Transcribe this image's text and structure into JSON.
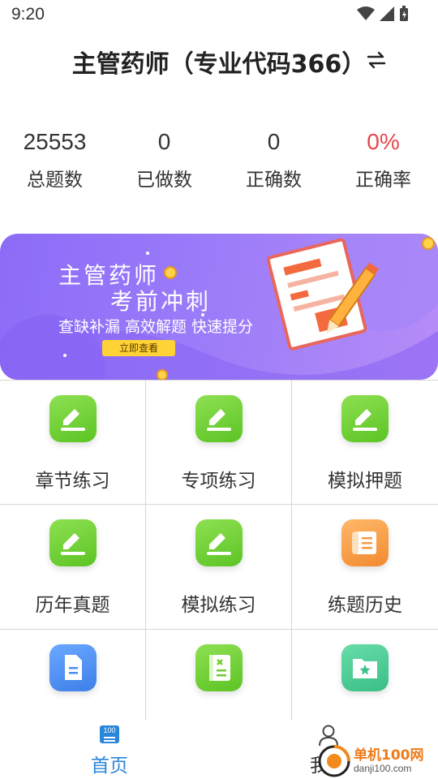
{
  "status_bar": {
    "time": "9:20"
  },
  "header": {
    "title": "主管药师（专业代码366）"
  },
  "stats": [
    {
      "value": "25553",
      "label": "总题数"
    },
    {
      "value": "0",
      "label": "已做数"
    },
    {
      "value": "0",
      "label": "正确数"
    },
    {
      "value": "0%",
      "label": "正确率"
    }
  ],
  "banner": {
    "line1": "主管药师",
    "line2": "考前冲刺",
    "tagline": "查缺补漏 高效解题 快速提分",
    "button": "立即查看"
  },
  "menu": [
    {
      "label": "章节练习",
      "icon": "pencil-icon",
      "color": "green"
    },
    {
      "label": "专项练习",
      "icon": "pencil-icon",
      "color": "green"
    },
    {
      "label": "模拟押题",
      "icon": "pencil-icon",
      "color": "green"
    },
    {
      "label": "历年真题",
      "icon": "pencil-icon",
      "color": "green"
    },
    {
      "label": "模拟练习",
      "icon": "pencil-icon",
      "color": "green"
    },
    {
      "label": "练题历史",
      "icon": "scroll-icon",
      "color": "orange"
    },
    {
      "label": "",
      "icon": "document-icon",
      "color": "blue"
    },
    {
      "label": "",
      "icon": "wrong-notebook-icon",
      "color": "green"
    },
    {
      "label": "",
      "icon": "favorite-folder-icon",
      "color": "teal"
    }
  ],
  "tabbar": {
    "home": {
      "label": "首页",
      "badge": "100"
    },
    "mine": {
      "label": "我的"
    }
  },
  "watermark": {
    "cn": "单机100网",
    "url": "danji100.com"
  },
  "colors": {
    "accent": "#2a86d9",
    "stat_red": "#e8464c",
    "banner": "#9a7bf9"
  }
}
